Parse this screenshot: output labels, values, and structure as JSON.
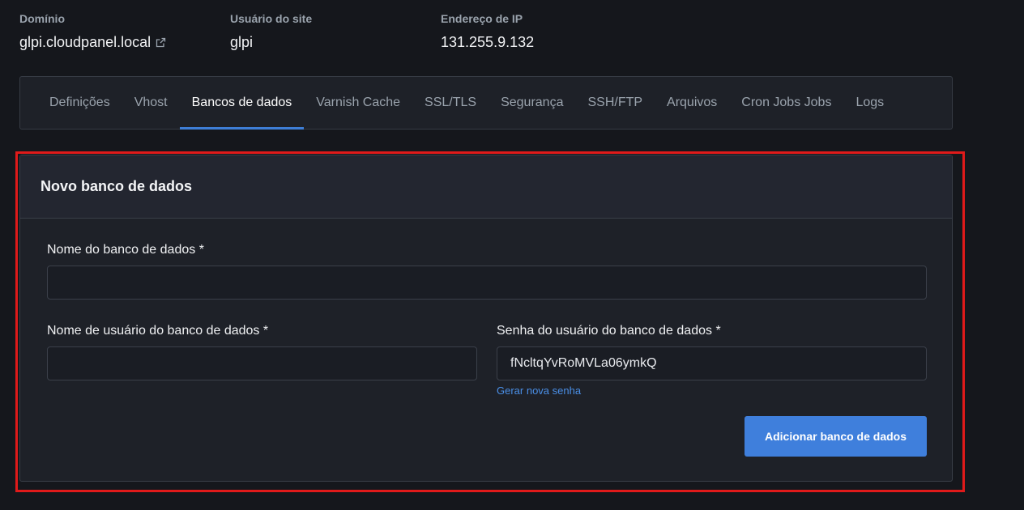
{
  "site_info": {
    "domain": {
      "label": "Domínio",
      "value": "glpi.cloudpanel.local"
    },
    "site_user": {
      "label": "Usuário do site",
      "value": "glpi"
    },
    "ip_address": {
      "label": "Endereço de IP",
      "value": "131.255.9.132"
    }
  },
  "tabs": [
    {
      "label": "Definições",
      "active": false
    },
    {
      "label": "Vhost",
      "active": false
    },
    {
      "label": "Bancos de dados",
      "active": true
    },
    {
      "label": "Varnish Cache",
      "active": false
    },
    {
      "label": "SSL/TLS",
      "active": false
    },
    {
      "label": "Segurança",
      "active": false
    },
    {
      "label": "SSH/FTP",
      "active": false
    },
    {
      "label": "Arquivos",
      "active": false
    },
    {
      "label": "Cron Jobs Jobs",
      "active": false
    },
    {
      "label": "Logs",
      "active": false
    }
  ],
  "form": {
    "title": "Novo banco de dados",
    "db_name": {
      "label": "Nome do banco de dados *",
      "value": ""
    },
    "db_user": {
      "label": "Nome de usuário do banco de dados *",
      "value": ""
    },
    "db_password": {
      "label": "Senha do usuário do banco de dados *",
      "value": "fNcltqYvRoMVLa06ymkQ"
    },
    "generate_password_label": "Gerar nova senha",
    "submit_label": "Adicionar banco de dados"
  },
  "colors": {
    "background": "#15171c",
    "panel": "#1e2128",
    "accent": "#3f7fdc",
    "link": "#4a8fe7",
    "highlight": "#e01a1a"
  }
}
